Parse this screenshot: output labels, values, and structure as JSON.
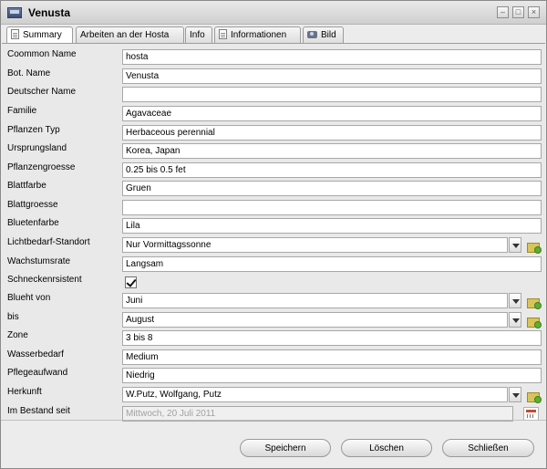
{
  "window": {
    "title": "Venusta"
  },
  "tabs": [
    {
      "label": "Summary",
      "icon": "document-icon",
      "active": true
    },
    {
      "label": "Arbeiten an der Hosta",
      "active": false
    },
    {
      "label": "Info",
      "active": false
    },
    {
      "label": "Informationen",
      "icon": "document-icon",
      "active": false
    },
    {
      "label": "Bild",
      "icon": "camera-icon",
      "active": false
    }
  ],
  "fields": {
    "common_name": {
      "label": "Coommon Name",
      "value": "hosta"
    },
    "bot_name": {
      "label": "Bot. Name",
      "value": "Venusta"
    },
    "deutscher_name": {
      "label": "Deutscher Name",
      "value": ""
    },
    "familie": {
      "label": "Familie",
      "value": "Agavaceae"
    },
    "pflanzen_typ": {
      "label": "Pflanzen Typ",
      "value": "Herbaceous perennial"
    },
    "ursprungsland": {
      "label": "Ursprungsland",
      "value": "Korea, Japan"
    },
    "pflanzengroesse": {
      "label": "Pflanzengroesse",
      "value": "0.25 bis 0.5 fet"
    },
    "blattfarbe": {
      "label": "Blattfarbe",
      "value": "Gruen"
    },
    "blattgroesse": {
      "label": "Blattgroesse",
      "value": ""
    },
    "bluetenfarbe": {
      "label": "Bluetenfarbe",
      "value": "Lila"
    },
    "lichtbedarf": {
      "label": "Lichtbedarf-Standort",
      "value": "Nur Vormittagssonne"
    },
    "wachstumsrate": {
      "label": "Wachstumsrate",
      "value": "Langsam"
    },
    "schneckenresistent": {
      "label": "Schneckenrsistent",
      "checked": true
    },
    "blueht_von": {
      "label": "Blueht von",
      "value": "Juni"
    },
    "bis": {
      "label": "bis",
      "value": "August"
    },
    "zone": {
      "label": "Zone",
      "value": "3 bis 8"
    },
    "wasserbedarf": {
      "label": "Wasserbedarf",
      "value": "Medium"
    },
    "pflegeaufwand": {
      "label": "Pflegeaufwand",
      "value": "Niedrig"
    },
    "herkunft": {
      "label": "Herkunft",
      "value": "W.Putz, Wolfgang, Putz"
    },
    "im_bestand_seit": {
      "label": "Im Bestand seit",
      "value": "Mittwoch, 20 Juli 2011"
    }
  },
  "buttons": {
    "save": "Speichern",
    "delete": "Löschen",
    "close": "Schließen"
  }
}
